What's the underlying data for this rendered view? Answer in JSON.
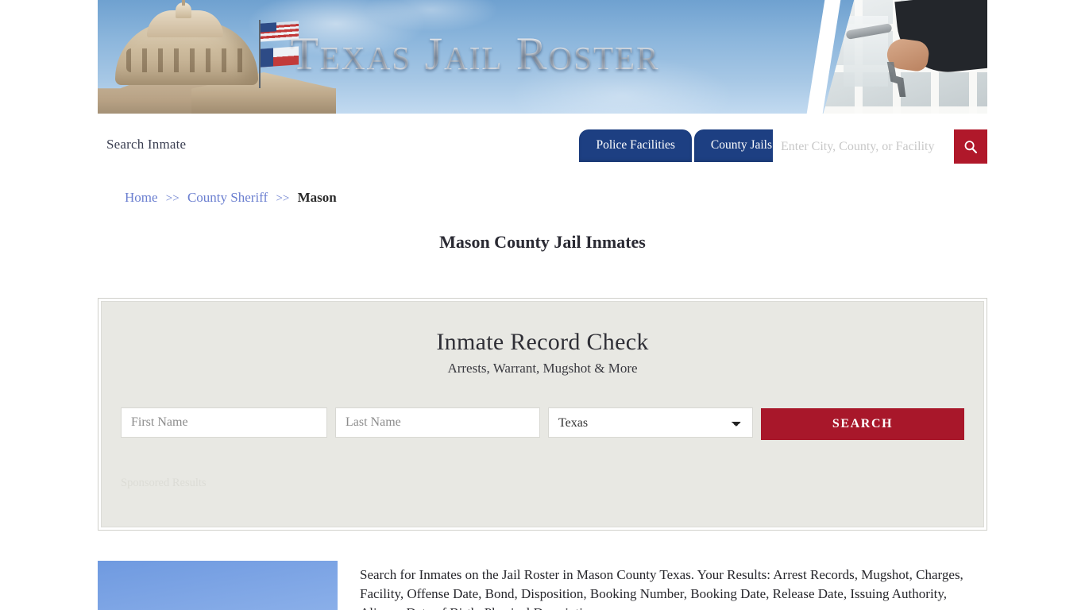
{
  "site": {
    "banner_title": "Texas Jail Roster"
  },
  "nav": {
    "search_inmate_label": "Search Inmate",
    "tabs": [
      {
        "label": "Police Facilities"
      },
      {
        "label": "County Jails"
      }
    ],
    "search": {
      "value": "",
      "placeholder": "Enter City, County, or Facility",
      "button_icon": "search-icon"
    }
  },
  "breadcrumb": {
    "items": [
      {
        "label": "Home",
        "link": true
      },
      {
        "label": "County Sheriff",
        "link": true
      },
      {
        "label": "Mason",
        "link": false
      }
    ],
    "separator": ">>"
  },
  "page": {
    "title": "Mason County Jail Inmates"
  },
  "record_panel": {
    "title": "Inmate Record Check",
    "subtitle": "Arrests, Warrant, Mugshot & More",
    "first_name": {
      "value": "",
      "placeholder": "First Name"
    },
    "last_name": {
      "value": "",
      "placeholder": "Last Name"
    },
    "state": {
      "selected": "Texas"
    },
    "search_button": "SEARCH",
    "sponsored_label": "Sponsored Results"
  },
  "content": {
    "description": "Search for Inmates on the Jail Roster in Mason County Texas. Your Results: Arrest Records, Mugshot, Charges, Facility, Offense Date, Bond, Disposition, Booking Number, Booking Date, Release Date, Issuing Authority, Aliases, Date of Birth, Physical Description"
  },
  "colors": {
    "nav_blue": "#1d3f82",
    "accent_red": "#a8172a",
    "search_btn_red": "#b0182a",
    "panel_bg": "#e8e8e3",
    "link_blue": "#6b7fd0"
  }
}
